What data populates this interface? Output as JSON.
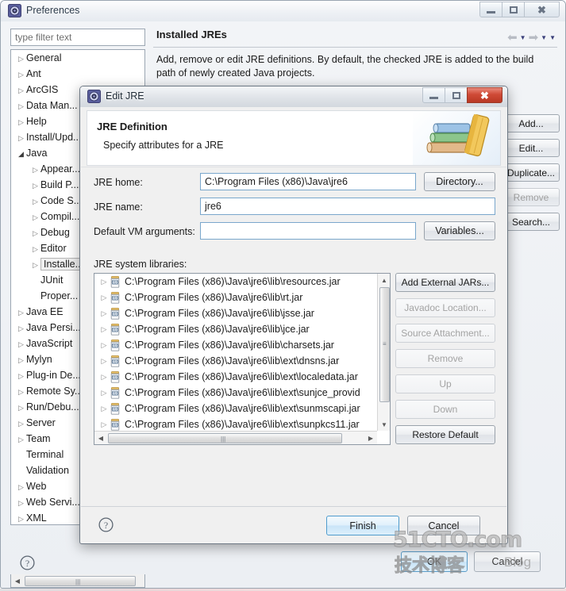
{
  "prefs_window": {
    "title": "Preferences",
    "title_icon": "preferences-gear-icon",
    "window_buttons": {
      "minimize": "minimize-icon",
      "maximize": "maximize-icon",
      "close": "close-icon"
    },
    "filter": {
      "placeholder": "type filter text",
      "value": ""
    },
    "tree_items": [
      {
        "label": "General",
        "level": 1,
        "arrow": "collapsed",
        "selected": false
      },
      {
        "label": "Ant",
        "level": 1,
        "arrow": "collapsed",
        "selected": false
      },
      {
        "label": "ArcGIS",
        "level": 1,
        "arrow": "collapsed",
        "selected": false
      },
      {
        "label": "Data Man...",
        "level": 1,
        "arrow": "collapsed",
        "selected": false
      },
      {
        "label": "Help",
        "level": 1,
        "arrow": "collapsed",
        "selected": false
      },
      {
        "label": "Install/Upd...",
        "level": 1,
        "arrow": "collapsed",
        "selected": false
      },
      {
        "label": "Java",
        "level": 1,
        "arrow": "expanded",
        "selected": false
      },
      {
        "label": "Appear...",
        "level": 2,
        "arrow": "collapsed",
        "selected": false
      },
      {
        "label": "Build P...",
        "level": 2,
        "arrow": "collapsed",
        "selected": false
      },
      {
        "label": "Code S...",
        "level": 2,
        "arrow": "collapsed",
        "selected": false
      },
      {
        "label": "Compil...",
        "level": 2,
        "arrow": "collapsed",
        "selected": false
      },
      {
        "label": "Debug",
        "level": 2,
        "arrow": "collapsed",
        "selected": false
      },
      {
        "label": "Editor",
        "level": 2,
        "arrow": "collapsed",
        "selected": false
      },
      {
        "label": "Installe...",
        "level": 2,
        "arrow": "collapsed",
        "selected": true
      },
      {
        "label": "JUnit",
        "level": 2,
        "arrow": "none",
        "selected": false
      },
      {
        "label": "Proper...",
        "level": 2,
        "arrow": "none",
        "selected": false
      },
      {
        "label": "Java EE",
        "level": 1,
        "arrow": "collapsed",
        "selected": false
      },
      {
        "label": "Java Persi...",
        "level": 1,
        "arrow": "collapsed",
        "selected": false
      },
      {
        "label": "JavaScript",
        "level": 1,
        "arrow": "collapsed",
        "selected": false
      },
      {
        "label": "Mylyn",
        "level": 1,
        "arrow": "collapsed",
        "selected": false
      },
      {
        "label": "Plug-in De...",
        "level": 1,
        "arrow": "collapsed",
        "selected": false
      },
      {
        "label": "Remote Sy...",
        "level": 1,
        "arrow": "collapsed",
        "selected": false
      },
      {
        "label": "Run/Debu...",
        "level": 1,
        "arrow": "collapsed",
        "selected": false
      },
      {
        "label": "Server",
        "level": 1,
        "arrow": "collapsed",
        "selected": false
      },
      {
        "label": "Team",
        "level": 1,
        "arrow": "collapsed",
        "selected": false
      },
      {
        "label": "Terminal",
        "level": 1,
        "arrow": "none",
        "selected": false
      },
      {
        "label": "Validation",
        "level": 1,
        "arrow": "none",
        "selected": false
      },
      {
        "label": "Web",
        "level": 1,
        "arrow": "collapsed",
        "selected": false
      },
      {
        "label": "Web Servi...",
        "level": 1,
        "arrow": "collapsed",
        "selected": false
      },
      {
        "label": "XML",
        "level": 1,
        "arrow": "collapsed",
        "selected": false
      }
    ],
    "content": {
      "title": "Installed JREs",
      "description": "Add, remove or edit JRE definitions. By default, the checked JRE is added to the build path of newly created Java projects.",
      "nav": {
        "back": "back-arrow-icon",
        "forward": "forward-arrow-icon",
        "menu": "view-menu-icon"
      }
    },
    "side_buttons": [
      {
        "label": "Add...",
        "enabled": true
      },
      {
        "label": "Edit...",
        "enabled": true
      },
      {
        "label": "Duplicate...",
        "enabled": true
      },
      {
        "label": "Remove",
        "enabled": false
      },
      {
        "label": "Search...",
        "enabled": true
      }
    ],
    "help_icon": "help-question-icon",
    "ok_label": "OK",
    "cancel_label": "Cancel"
  },
  "jre_dialog": {
    "title": "Edit JRE",
    "title_icon": "edit-jre-gear-icon",
    "window_buttons": {
      "minimize": "minimize-icon",
      "maximize": "maximize-icon",
      "close": "close-icon"
    },
    "header": {
      "title": "JRE Definition",
      "subtitle": "Specify attributes for a JRE",
      "image": "books-stack-icon"
    },
    "fields": [
      {
        "label": "JRE home:",
        "value": "C:\\Program Files (x86)\\Java\\jre6",
        "button": "Directory..."
      },
      {
        "label": "JRE name:",
        "value": "jre6",
        "button": ""
      },
      {
        "label": "Default VM arguments:",
        "value": "",
        "button": "Variables..."
      }
    ],
    "libraries_label": "JRE system libraries:",
    "libraries": [
      "C:\\Program Files (x86)\\Java\\jre6\\lib\\resources.jar",
      "C:\\Program Files (x86)\\Java\\jre6\\lib\\rt.jar",
      "C:\\Program Files (x86)\\Java\\jre6\\lib\\jsse.jar",
      "C:\\Program Files (x86)\\Java\\jre6\\lib\\jce.jar",
      "C:\\Program Files (x86)\\Java\\jre6\\lib\\charsets.jar",
      "C:\\Program Files (x86)\\Java\\jre6\\lib\\ext\\dnsns.jar",
      "C:\\Program Files (x86)\\Java\\jre6\\lib\\ext\\localedata.jar",
      "C:\\Program Files (x86)\\Java\\jre6\\lib\\ext\\sunjce_provid",
      "C:\\Program Files (x86)\\Java\\jre6\\lib\\ext\\sunmscapi.jar",
      "C:\\Program Files (x86)\\Java\\jre6\\lib\\ext\\sunpkcs11.jar"
    ],
    "library_icon": "jar-file-icon",
    "side_buttons": [
      {
        "label": "Add External JARs...",
        "enabled": true
      },
      {
        "label": "Javadoc Location...",
        "enabled": false
      },
      {
        "label": "Source Attachment...",
        "enabled": false
      },
      {
        "label": "Remove",
        "enabled": false
      },
      {
        "label": "Up",
        "enabled": false
      },
      {
        "label": "Down",
        "enabled": false
      },
      {
        "label": "Restore Default",
        "enabled": true
      }
    ],
    "help_icon": "help-question-icon",
    "finish_label": "Finish",
    "cancel_label": "Cancel"
  },
  "watermark": {
    "line1": "51CTO.com",
    "line2": "技术博客",
    "line3": "Blog"
  },
  "colors": {
    "accent_blue": "#4f9ccd",
    "close_red": "#b93824",
    "selection_gray": "#f0f0f0",
    "window_bg": "#f0f0f0"
  }
}
